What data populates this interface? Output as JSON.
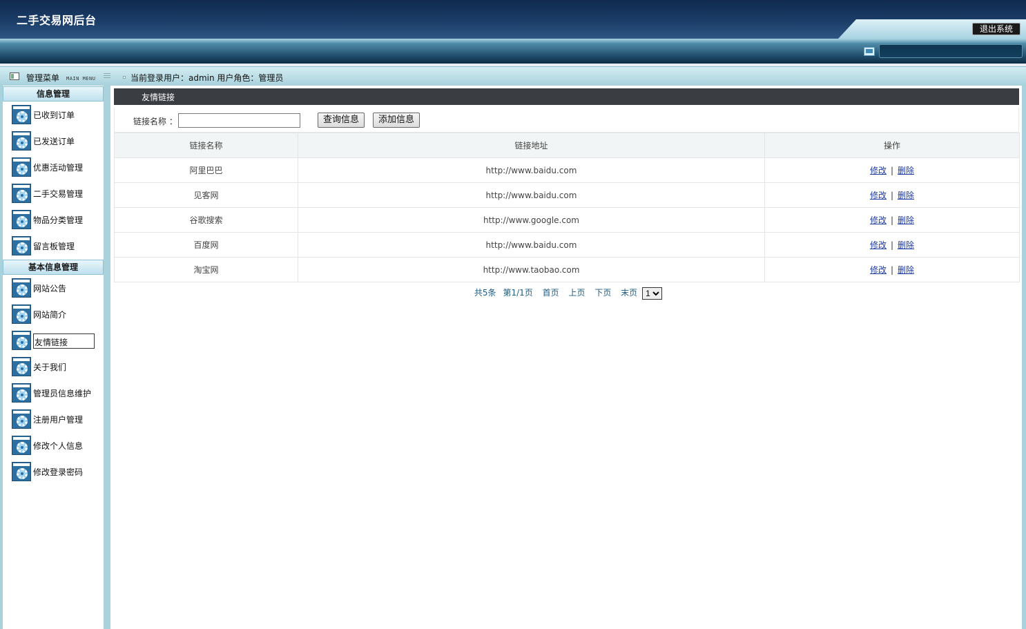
{
  "header": {
    "app_title": "二手交易网后台",
    "logout_label": "退出系统"
  },
  "sidebar": {
    "title": "管理菜单",
    "subtitle": "MAIN MENU",
    "sections": [
      {
        "title": "信息管理",
        "items": [
          {
            "label": "已收到订单"
          },
          {
            "label": "已发送订单"
          },
          {
            "label": "优惠活动管理"
          },
          {
            "label": "二手交易管理"
          },
          {
            "label": "物品分类管理"
          },
          {
            "label": "留言板管理"
          }
        ]
      },
      {
        "title": "基本信息管理",
        "items": [
          {
            "label": "网站公告"
          },
          {
            "label": "网站简介"
          },
          {
            "label": "友情链接",
            "active": true
          },
          {
            "label": "关于我们"
          },
          {
            "label": "管理员信息维护"
          },
          {
            "label": "注册用户管理"
          },
          {
            "label": "修改个人信息"
          },
          {
            "label": "修改登录密码"
          }
        ]
      }
    ]
  },
  "userbar": {
    "text": "当前登录用户：admin  用户角色：管理员"
  },
  "panel": {
    "title": "友情链接",
    "search": {
      "label": "链接名称 ：",
      "value": "",
      "query_button": "查询信息",
      "add_button": "添加信息"
    },
    "table": {
      "columns": [
        "链接名称",
        "链接地址",
        "操作"
      ],
      "rows": [
        {
          "name": "阿里巴巴",
          "url": "http://www.baidu.com",
          "edit": "修改",
          "delete": "删除"
        },
        {
          "name": "见客网",
          "url": "http://www.baidu.com",
          "edit": "修改",
          "delete": "删除"
        },
        {
          "name": "谷歌搜索",
          "url": "http://www.google.com",
          "edit": "修改",
          "delete": "删除"
        },
        {
          "name": "百度网",
          "url": "http://www.baidu.com",
          "edit": "修改",
          "delete": "删除"
        },
        {
          "name": "淘宝网",
          "url": "http://www.taobao.com",
          "edit": "修改",
          "delete": "删除"
        }
      ]
    },
    "pager": {
      "total": "共5条",
      "page_info": "第1/1页",
      "first": "首页",
      "prev": "上页",
      "next": "下页",
      "last": "末页",
      "selected_page": "1"
    }
  },
  "colors": {
    "header_dark": "#0f2a4e",
    "frame_light_blue": "#aad2dc",
    "panel_title_bg": "#3a3d42",
    "link_color": "#1c3aa5"
  },
  "icons": {
    "menu_item": "gear-window-icon",
    "menu_head": "menu-panel-icon",
    "status": "monitor-icon"
  }
}
